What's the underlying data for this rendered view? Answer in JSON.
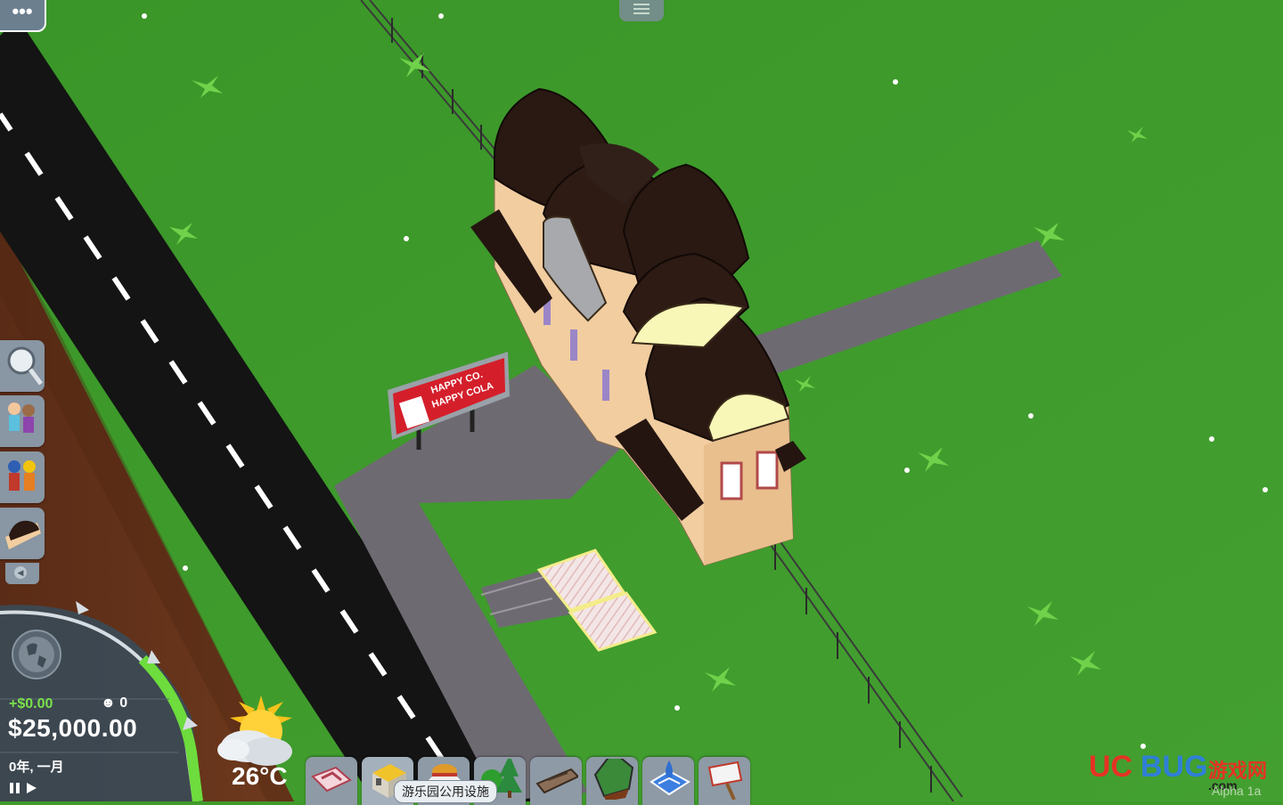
{
  "top_bar": {
    "menu_label": "•••",
    "handle_icon": "hamburger-icon"
  },
  "side_tools": [
    {
      "name": "magnifier-icon"
    },
    {
      "name": "guests-icon"
    },
    {
      "name": "staff-icon"
    },
    {
      "name": "building-icon"
    }
  ],
  "billboard": {
    "line1": "HAPPY CO.",
    "line2": "HAPPY COLA"
  },
  "dashboard": {
    "money_delta": "+$0.00",
    "guest_count": "0",
    "cash": "$25,000.00",
    "date": "0年, 一月",
    "temperature": "26°C"
  },
  "toolbar": {
    "items": [
      {
        "name": "paths-icon"
      },
      {
        "name": "park-utilities-icon"
      },
      {
        "name": "food-stall-icon"
      },
      {
        "name": "scenery-trees-icon"
      },
      {
        "name": "terrain-icon"
      },
      {
        "name": "terraform-icon"
      },
      {
        "name": "water-icon"
      },
      {
        "name": "signs-icon"
      }
    ],
    "tooltip": "游乐园公用设施"
  },
  "watermark": {
    "brand_uc": "UC",
    "brand_bug": "BUG",
    "brand_cn": "游戏网",
    "brand_com": ".com"
  },
  "version": "Alpha 1a",
  "colors": {
    "grass": "#3f9a2a",
    "road": "#121212",
    "path": "#6e6a72",
    "roof": "#2a1812",
    "building": "#f2cfa0",
    "money_positive": "#7be14c"
  }
}
